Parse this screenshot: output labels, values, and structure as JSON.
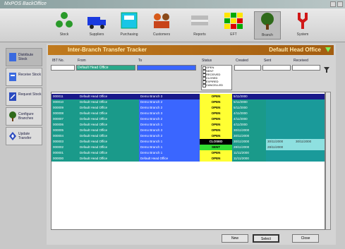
{
  "window": {
    "title": "MxPOS BackOffice"
  },
  "toolbar": {
    "items": [
      {
        "label": "Stock",
        "icon": "stock-icon"
      },
      {
        "label": "Suppliers",
        "icon": "supplier-truck-icon"
      },
      {
        "label": "Purchasing",
        "icon": "purchasing-icon"
      },
      {
        "label": "Customers",
        "icon": "customers-icon"
      },
      {
        "label": "Reports",
        "icon": "reports-icon"
      },
      {
        "label": "EFT",
        "icon": "eft-grid-icon"
      },
      {
        "label": "Branch",
        "icon": "branch-tree-icon"
      },
      {
        "label": "System",
        "icon": "system-icon"
      }
    ]
  },
  "sidebar": {
    "items": [
      {
        "label": "Distribute Stock"
      },
      {
        "label": "Receive Stock"
      },
      {
        "label": "Request Stock"
      },
      {
        "label": "Configure Branches"
      },
      {
        "label": "Update Transfer"
      }
    ]
  },
  "header": {
    "title": "Inter-Branch Transfer Tracker",
    "office": "Default Head Office"
  },
  "filters": {
    "ibt_label": "IBT No.",
    "from_label": "From",
    "to_label": "To",
    "status_label": "Status",
    "created_label": "Created",
    "sent_label": "Sent",
    "received_label": "Received",
    "from_value": "Default Head Office",
    "status_options": [
      "OPEN",
      "SENT",
      "RECEIVED",
      "CLOSED",
      "EXPIRED",
      "CANCELLED"
    ]
  },
  "rows": [
    {
      "ibt": "000011",
      "from": "Default Head Office",
      "to": "Demo Branch 3",
      "status": "OPEN",
      "created": "5/11/2000",
      "sent": "",
      "received": "",
      "selected": true
    },
    {
      "ibt": "000010",
      "from": "Default Head Office",
      "to": "Demo Branch 2",
      "status": "OPEN",
      "created": "5/11/2000",
      "sent": "",
      "received": ""
    },
    {
      "ibt": "000009",
      "from": "Default Head Office",
      "to": "Demo Branch 2",
      "status": "OPEN",
      "created": "5/11/2000",
      "sent": "",
      "received": ""
    },
    {
      "ibt": "000008",
      "from": "Default Head Office",
      "to": "Demo Branch 3",
      "status": "OPEN",
      "created": "4/11/2000",
      "sent": "",
      "received": ""
    },
    {
      "ibt": "000007",
      "from": "Default Head Office",
      "to": "Demo Branch 2",
      "status": "OPEN",
      "created": "4/11/2000",
      "sent": "",
      "received": ""
    },
    {
      "ibt": "000006",
      "from": "Default Head Office",
      "to": "Demo Branch 1",
      "status": "OPEN",
      "created": "4/11/2000",
      "sent": "",
      "received": ""
    },
    {
      "ibt": "000005",
      "from": "Default Head Office",
      "to": "Demo Branch 3",
      "status": "OPEN",
      "created": "30/11/2000",
      "sent": "",
      "received": ""
    },
    {
      "ibt": "000004",
      "from": "Default Head Office",
      "to": "Demo Branch 2",
      "status": "OPEN",
      "created": "30/11/2000",
      "sent": "",
      "received": ""
    },
    {
      "ibt": "000003",
      "from": "Default Head Office",
      "to": "Demo Branch 1",
      "status": "CLOSED",
      "created": "30/11/2000",
      "sent": "30/11/2000",
      "received": "30/11/2000"
    },
    {
      "ibt": "000002",
      "from": "Default Head Office",
      "to": "Demo Branch 1",
      "status": "SENT",
      "created": "28/11/2000",
      "sent": "28/11/2000",
      "received": ""
    },
    {
      "ibt": "000001",
      "from": "Default Head Office",
      "to": "Demo Branch 1",
      "status": "OPEN",
      "created": "11/11/2000",
      "sent": "",
      "received": ""
    },
    {
      "ibt": "000000",
      "from": "Default Head Office",
      "to": "Default Head Office",
      "status": "OPEN",
      "created": "11/11/2000",
      "sent": "",
      "received": ""
    }
  ],
  "buttons": {
    "new": "New",
    "select": "Select",
    "close": "Close"
  },
  "colors": {
    "selected_row": "#1a1a8a",
    "teal": "#1a9a8a",
    "blue": "#3a66ff",
    "open": "#ffff33",
    "closed": "#000000",
    "sent": "#33dd33"
  }
}
